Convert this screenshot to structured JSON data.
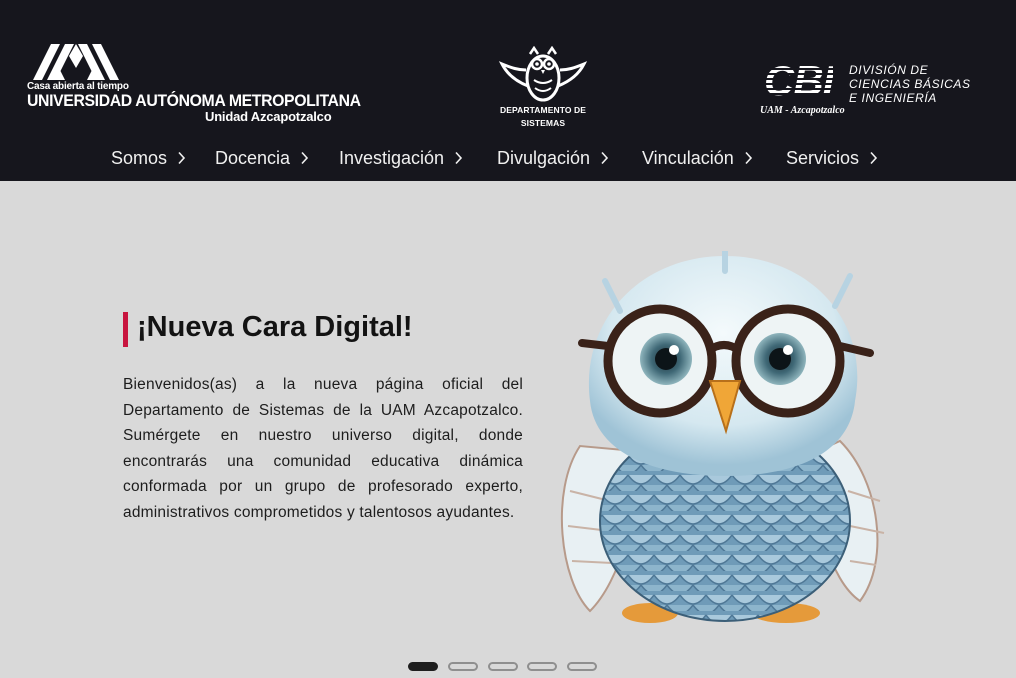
{
  "header": {
    "uam": {
      "tagline": "Casa abierta al tiempo",
      "name": "UNIVERSIDAD AUTÓNOMA METROPOLITANA",
      "unit": "Unidad Azcapotzalco"
    },
    "department": {
      "line1": "DEPARTAMENTO DE",
      "line2": "SISTEMAS"
    },
    "cbi": {
      "mark": "CBI",
      "line1": "DIVISIÓN DE",
      "line2": "CIENCIAS BÁSICAS",
      "line3": "E INGENIERÍA",
      "sub": "UAM - Azcapotzalco"
    }
  },
  "nav": {
    "items": [
      {
        "label": "Somos"
      },
      {
        "label": "Docencia"
      },
      {
        "label": "Investigación"
      },
      {
        "label": "Divulgación"
      },
      {
        "label": "Vinculación"
      },
      {
        "label": "Servicios"
      }
    ]
  },
  "hero": {
    "title": "¡Nueva Cara Digital!",
    "text": "Bienvenidos(as) a la nueva página oficial del Departamento de Sistemas de la UAM Azcapotzalco. Sumérgete en nuestro universo digital, donde encontrarás una comunidad educativa dinámica conformada por un grupo de profesorado experto, administrativos comprometidos y talentosos ayudantes."
  },
  "carousel": {
    "slide_count": 5,
    "active_index": 0
  },
  "colors": {
    "header_bg": "#16161d",
    "hero_bg": "#d9d9d9",
    "accent": "#c8153f"
  }
}
